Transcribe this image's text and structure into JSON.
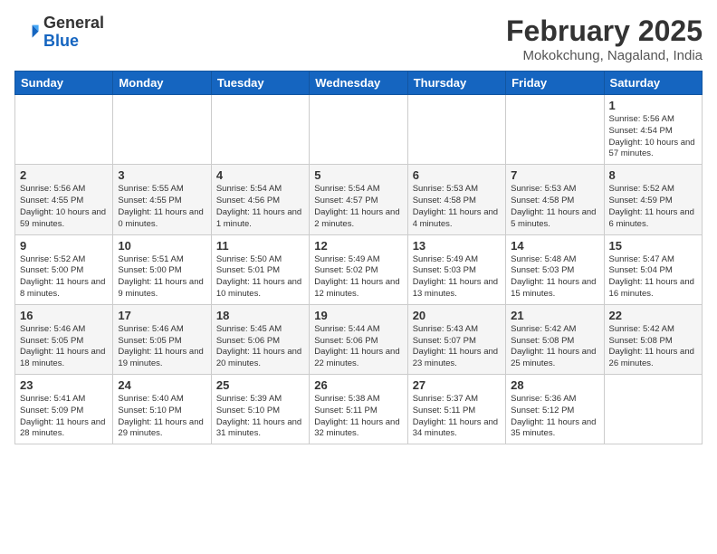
{
  "header": {
    "logo": {
      "general": "General",
      "blue": "Blue"
    },
    "title": "February 2025",
    "location": "Mokokchung, Nagaland, India"
  },
  "days_of_week": [
    "Sunday",
    "Monday",
    "Tuesday",
    "Wednesday",
    "Thursday",
    "Friday",
    "Saturday"
  ],
  "weeks": [
    [
      {
        "day": null,
        "info": null
      },
      {
        "day": null,
        "info": null
      },
      {
        "day": null,
        "info": null
      },
      {
        "day": null,
        "info": null
      },
      {
        "day": null,
        "info": null
      },
      {
        "day": null,
        "info": null
      },
      {
        "day": "1",
        "info": "Sunrise: 5:56 AM\nSunset: 4:54 PM\nDaylight: 10 hours and 57 minutes."
      }
    ],
    [
      {
        "day": "2",
        "info": "Sunrise: 5:56 AM\nSunset: 4:55 PM\nDaylight: 10 hours and 59 minutes."
      },
      {
        "day": "3",
        "info": "Sunrise: 5:55 AM\nSunset: 4:55 PM\nDaylight: 11 hours and 0 minutes."
      },
      {
        "day": "4",
        "info": "Sunrise: 5:54 AM\nSunset: 4:56 PM\nDaylight: 11 hours and 1 minute."
      },
      {
        "day": "5",
        "info": "Sunrise: 5:54 AM\nSunset: 4:57 PM\nDaylight: 11 hours and 2 minutes."
      },
      {
        "day": "6",
        "info": "Sunrise: 5:53 AM\nSunset: 4:58 PM\nDaylight: 11 hours and 4 minutes."
      },
      {
        "day": "7",
        "info": "Sunrise: 5:53 AM\nSunset: 4:58 PM\nDaylight: 11 hours and 5 minutes."
      },
      {
        "day": "8",
        "info": "Sunrise: 5:52 AM\nSunset: 4:59 PM\nDaylight: 11 hours and 6 minutes."
      }
    ],
    [
      {
        "day": "9",
        "info": "Sunrise: 5:52 AM\nSunset: 5:00 PM\nDaylight: 11 hours and 8 minutes."
      },
      {
        "day": "10",
        "info": "Sunrise: 5:51 AM\nSunset: 5:00 PM\nDaylight: 11 hours and 9 minutes."
      },
      {
        "day": "11",
        "info": "Sunrise: 5:50 AM\nSunset: 5:01 PM\nDaylight: 11 hours and 10 minutes."
      },
      {
        "day": "12",
        "info": "Sunrise: 5:49 AM\nSunset: 5:02 PM\nDaylight: 11 hours and 12 minutes."
      },
      {
        "day": "13",
        "info": "Sunrise: 5:49 AM\nSunset: 5:03 PM\nDaylight: 11 hours and 13 minutes."
      },
      {
        "day": "14",
        "info": "Sunrise: 5:48 AM\nSunset: 5:03 PM\nDaylight: 11 hours and 15 minutes."
      },
      {
        "day": "15",
        "info": "Sunrise: 5:47 AM\nSunset: 5:04 PM\nDaylight: 11 hours and 16 minutes."
      }
    ],
    [
      {
        "day": "16",
        "info": "Sunrise: 5:46 AM\nSunset: 5:05 PM\nDaylight: 11 hours and 18 minutes."
      },
      {
        "day": "17",
        "info": "Sunrise: 5:46 AM\nSunset: 5:05 PM\nDaylight: 11 hours and 19 minutes."
      },
      {
        "day": "18",
        "info": "Sunrise: 5:45 AM\nSunset: 5:06 PM\nDaylight: 11 hours and 20 minutes."
      },
      {
        "day": "19",
        "info": "Sunrise: 5:44 AM\nSunset: 5:06 PM\nDaylight: 11 hours and 22 minutes."
      },
      {
        "day": "20",
        "info": "Sunrise: 5:43 AM\nSunset: 5:07 PM\nDaylight: 11 hours and 23 minutes."
      },
      {
        "day": "21",
        "info": "Sunrise: 5:42 AM\nSunset: 5:08 PM\nDaylight: 11 hours and 25 minutes."
      },
      {
        "day": "22",
        "info": "Sunrise: 5:42 AM\nSunset: 5:08 PM\nDaylight: 11 hours and 26 minutes."
      }
    ],
    [
      {
        "day": "23",
        "info": "Sunrise: 5:41 AM\nSunset: 5:09 PM\nDaylight: 11 hours and 28 minutes."
      },
      {
        "day": "24",
        "info": "Sunrise: 5:40 AM\nSunset: 5:10 PM\nDaylight: 11 hours and 29 minutes."
      },
      {
        "day": "25",
        "info": "Sunrise: 5:39 AM\nSunset: 5:10 PM\nDaylight: 11 hours and 31 minutes."
      },
      {
        "day": "26",
        "info": "Sunrise: 5:38 AM\nSunset: 5:11 PM\nDaylight: 11 hours and 32 minutes."
      },
      {
        "day": "27",
        "info": "Sunrise: 5:37 AM\nSunset: 5:11 PM\nDaylight: 11 hours and 34 minutes."
      },
      {
        "day": "28",
        "info": "Sunrise: 5:36 AM\nSunset: 5:12 PM\nDaylight: 11 hours and 35 minutes."
      },
      {
        "day": null,
        "info": null
      }
    ]
  ]
}
